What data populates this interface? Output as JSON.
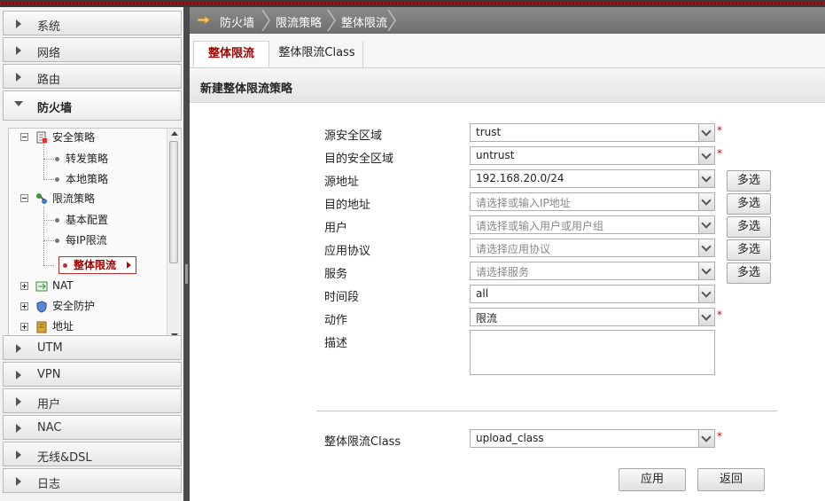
{
  "nav": {
    "top_items": [
      "系统",
      "网络",
      "路由"
    ],
    "open_item": "防火墙",
    "bottom_items": [
      "UTM",
      "VPN",
      "用户",
      "NAC",
      "无线&DSL",
      "日志"
    ]
  },
  "tree": {
    "security_policy": "安全策略",
    "forward_policy": "转发策略",
    "local_policy": "本地策略",
    "rate_policy": "限流策略",
    "basic_config": "基本配置",
    "per_ip_limit": "每IP限流",
    "overall_limit": "整体限流",
    "nat": "NAT",
    "protection": "安全防护",
    "address": "地址"
  },
  "breadcrumb": [
    "防火墙",
    "限流策略",
    "整体限流"
  ],
  "tabs": [
    "整体限流",
    "整体限流Class"
  ],
  "pane_title": "新建整体限流策略",
  "form": {
    "src_zone": {
      "label": "源安全区域",
      "value": "trust"
    },
    "dst_zone": {
      "label": "目的安全区域",
      "value": "untrust"
    },
    "src_addr": {
      "label": "源地址",
      "value": "192.168.20.0/24"
    },
    "dst_addr": {
      "label": "目的地址",
      "placeholder": "请选择或输入IP地址"
    },
    "user": {
      "label": "用户",
      "placeholder": "请选择或输入用户或用户组"
    },
    "app": {
      "label": "应用协议",
      "placeholder": "请选择应用协议"
    },
    "service": {
      "label": "服务",
      "placeholder": "请选择服务"
    },
    "schedule": {
      "label": "时间段",
      "value": "all"
    },
    "action": {
      "label": "动作",
      "value": "限流"
    },
    "desc": {
      "label": "描述"
    },
    "class": {
      "label": "整体限流Class",
      "value": "upload_class"
    },
    "required_mark": "*",
    "multi_label": "多选"
  },
  "buttons": {
    "apply": "应用",
    "back": "返回"
  },
  "colors": {
    "accent": "#a00000",
    "crumb_bar": "#7a7a7a",
    "required": "#dd0000"
  }
}
